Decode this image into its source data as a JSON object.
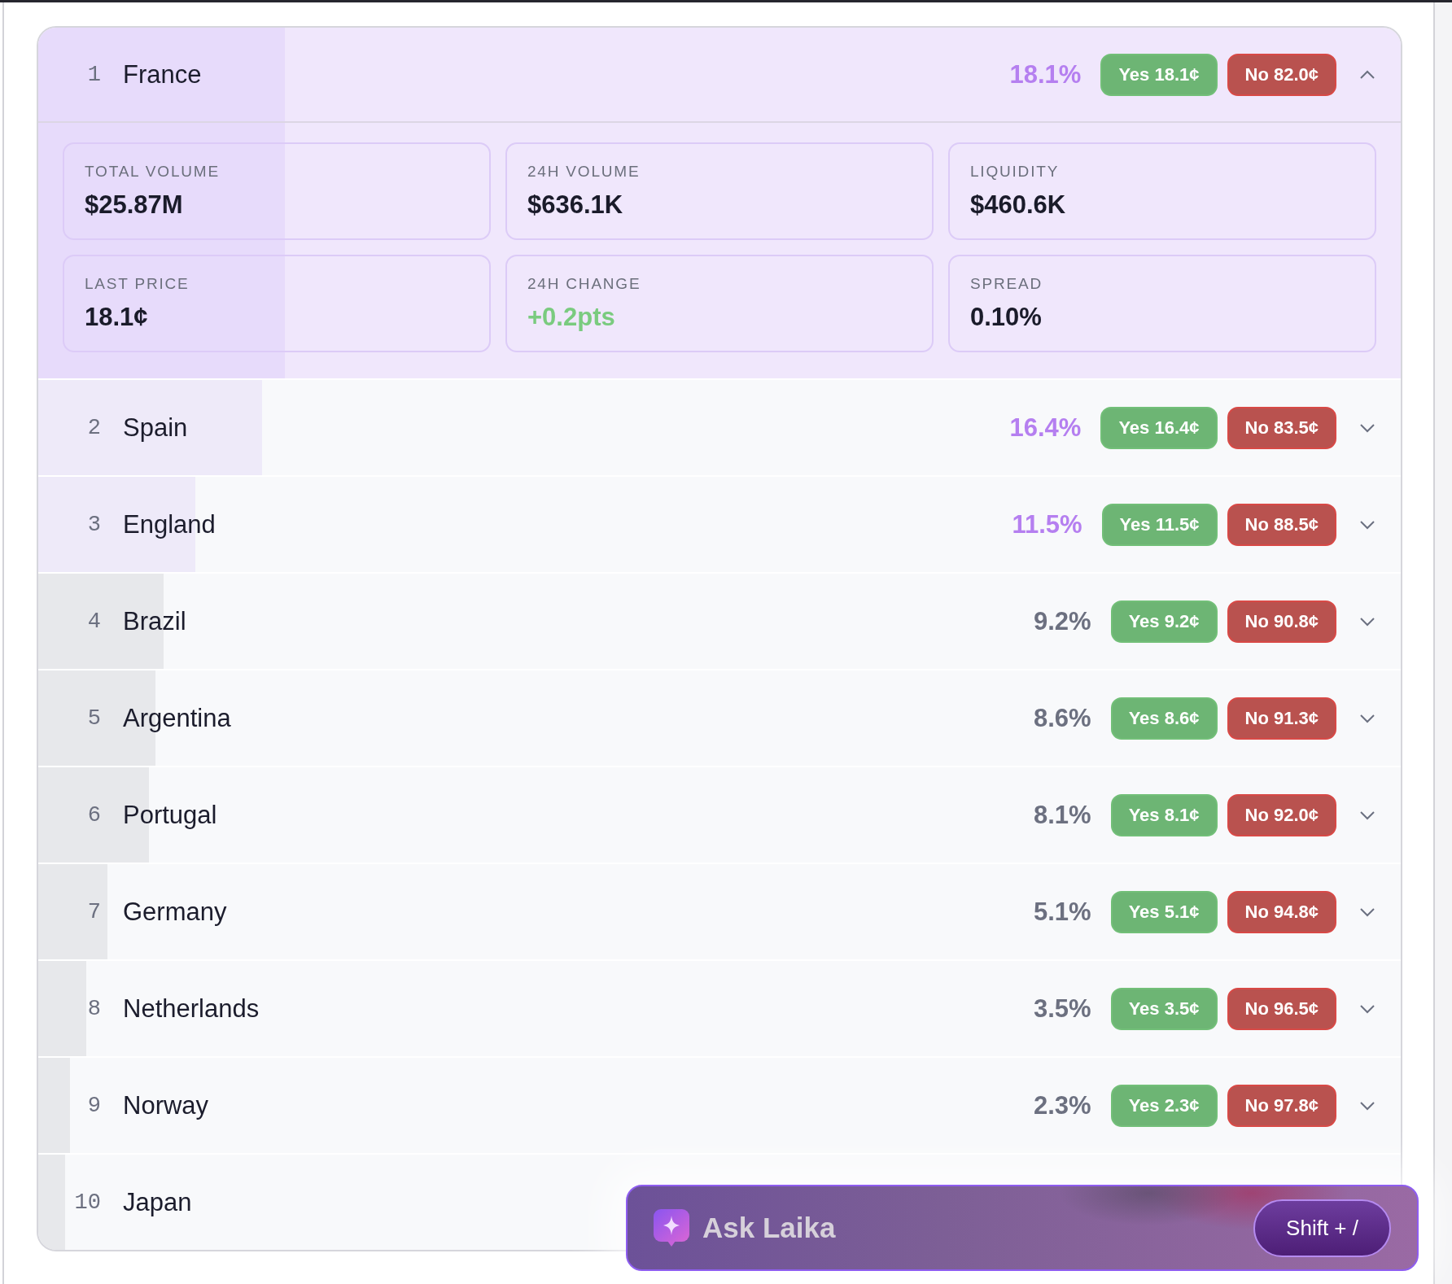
{
  "rows": [
    {
      "rank": "1",
      "name": "France",
      "percent": "18.1%",
      "yes": "Yes 18.1¢",
      "no": "No 82.0¢",
      "level": 0.181,
      "highlighted": true,
      "expanded": true,
      "stats": [
        {
          "label": "TOTAL VOLUME",
          "value": "$25.87M",
          "kind": "plain"
        },
        {
          "label": "24H VOLUME",
          "value": "$636.1K",
          "kind": "plain"
        },
        {
          "label": "LIQUIDITY",
          "value": "$460.6K",
          "kind": "plain"
        },
        {
          "label": "LAST PRICE",
          "value": "18.1¢",
          "kind": "plain"
        },
        {
          "label": "24H CHANGE",
          "value": "+0.2pts",
          "kind": "positive"
        },
        {
          "label": "SPREAD",
          "value": "0.10%",
          "kind": "plain"
        }
      ]
    },
    {
      "rank": "2",
      "name": "Spain",
      "percent": "16.4%",
      "yes": "Yes 16.4¢",
      "no": "No 83.5¢",
      "level": 0.164,
      "highlighted": true,
      "expanded": false
    },
    {
      "rank": "3",
      "name": "England",
      "percent": "11.5%",
      "yes": "Yes 11.5¢",
      "no": "No 88.5¢",
      "level": 0.115,
      "highlighted": true,
      "expanded": false
    },
    {
      "rank": "4",
      "name": "Brazil",
      "percent": "9.2%",
      "yes": "Yes 9.2¢",
      "no": "No 90.8¢",
      "level": 0.092,
      "highlighted": false,
      "expanded": false
    },
    {
      "rank": "5",
      "name": "Argentina",
      "percent": "8.6%",
      "yes": "Yes 8.6¢",
      "no": "No 91.3¢",
      "level": 0.086,
      "highlighted": false,
      "expanded": false
    },
    {
      "rank": "6",
      "name": "Portugal",
      "percent": "8.1%",
      "yes": "Yes 8.1¢",
      "no": "No 92.0¢",
      "level": 0.081,
      "highlighted": false,
      "expanded": false
    },
    {
      "rank": "7",
      "name": "Germany",
      "percent": "5.1%",
      "yes": "Yes 5.1¢",
      "no": "No 94.8¢",
      "level": 0.051,
      "highlighted": false,
      "expanded": false
    },
    {
      "rank": "8",
      "name": "Netherlands",
      "percent": "3.5%",
      "yes": "Yes 3.5¢",
      "no": "No 96.5¢",
      "level": 0.035,
      "highlighted": false,
      "expanded": false
    },
    {
      "rank": "9",
      "name": "Norway",
      "percent": "2.3%",
      "yes": "Yes 2.3¢",
      "no": "No 97.8¢",
      "level": 0.023,
      "highlighted": false,
      "expanded": false
    },
    {
      "rank": "10",
      "name": "Japan",
      "level": 0.02,
      "highlighted": false
    }
  ],
  "assistant": {
    "label": "Ask Laika",
    "shortcut": "Shift + /"
  }
}
